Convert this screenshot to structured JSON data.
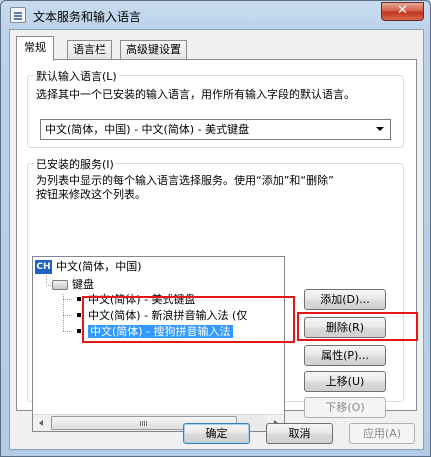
{
  "window": {
    "title": "文本服务和输入语言",
    "close_label": "✕"
  },
  "tabs": [
    {
      "label": "常规"
    },
    {
      "label": "语言栏"
    },
    {
      "label": "高级键设置"
    }
  ],
  "default_language": {
    "group_title": "默认输入语言(L)",
    "description": "选择其中一个已安装的输入语言，用作所有输入字段的默认语言。",
    "selected": "中文(简体，中国) - 中文(简体) - 美式键盘"
  },
  "installed_services": {
    "group_title": "已安装的服务(I)",
    "description_line1": "为列表中显示的每个输入语言选择服务。使用“添加”和“删除”",
    "description_line2": "按钮来修改这个列表。",
    "tree": {
      "language_badge": "CH",
      "language": "中文(简体，中国)",
      "keyboard_label": "键盘",
      "items": [
        {
          "label": "中文(简体) - 美式键盘",
          "selected": false
        },
        {
          "label": "中文(简体) - 新浪拼音输入法 (仅",
          "selected": false
        },
        {
          "label": "中文(简体) - 搜狗拼音输入法",
          "selected": true
        }
      ]
    },
    "buttons": {
      "add": "添加(D)...",
      "remove": "删除(R)",
      "properties": "属性(P)...",
      "move_up": "上移(U)",
      "move_down": "下移(O)"
    }
  },
  "footer": {
    "ok": "确定",
    "cancel": "取消",
    "apply": "应用(A)"
  },
  "colors": {
    "selection": "#3399ff",
    "highlight_border": "#e21818",
    "language_badge": "#1f62c4"
  }
}
